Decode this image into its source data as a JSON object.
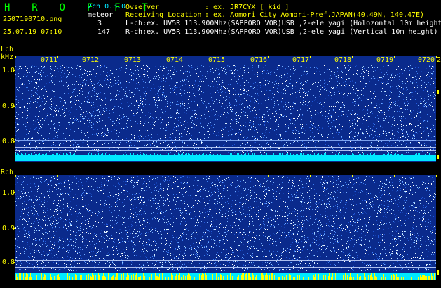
{
  "header": {
    "title": "H R O F F T",
    "filename": "2507190710.png",
    "datetime": "25.07.19 07:10",
    "channel_mode": "2ch 0.3.0",
    "meteor_label": "meteor",
    "lch_count": "3",
    "rch_count": "147",
    "observer_label": "Ovserver",
    "observer_value": ": ex. JR7CYX [ kid ]",
    "location_label": "Receiving Location",
    "location_value": ": ex. Aomori City Aomori-Pref.JAPAN(40.49N, 140.47E)",
    "lch_info": "L-ch:ex. UV5R 113.900Mhz(SAPPORO VOR)USB ,2-ele yagi (Holozontal 10m height",
    "rch_info": "R-ch:ex. UV5R 113.900Mhz(SAPPORO VOR)USB ,2-ele yagi (Vertical 10m height)"
  },
  "axis": {
    "lch_label": "Lch",
    "unit_label": "kHz",
    "rch_label": "Rch",
    "time_ticks": [
      "0711",
      "0712",
      "0713",
      "0714",
      "0715",
      "0716",
      "0717",
      "0718",
      "0719",
      "0720"
    ],
    "time_edge": "2",
    "freq_ticks": [
      "1.0",
      "0.9",
      "0.8"
    ]
  },
  "colors": {
    "background": "#000000",
    "spectrogram_base": "#0a2a8c",
    "noise_floor_band": "#00e8ff",
    "meteor_bursts": "#ffff00",
    "label_cyan": "#00e8ff",
    "label_yellow": "#ffff00",
    "title_green": "#00ff00"
  }
}
